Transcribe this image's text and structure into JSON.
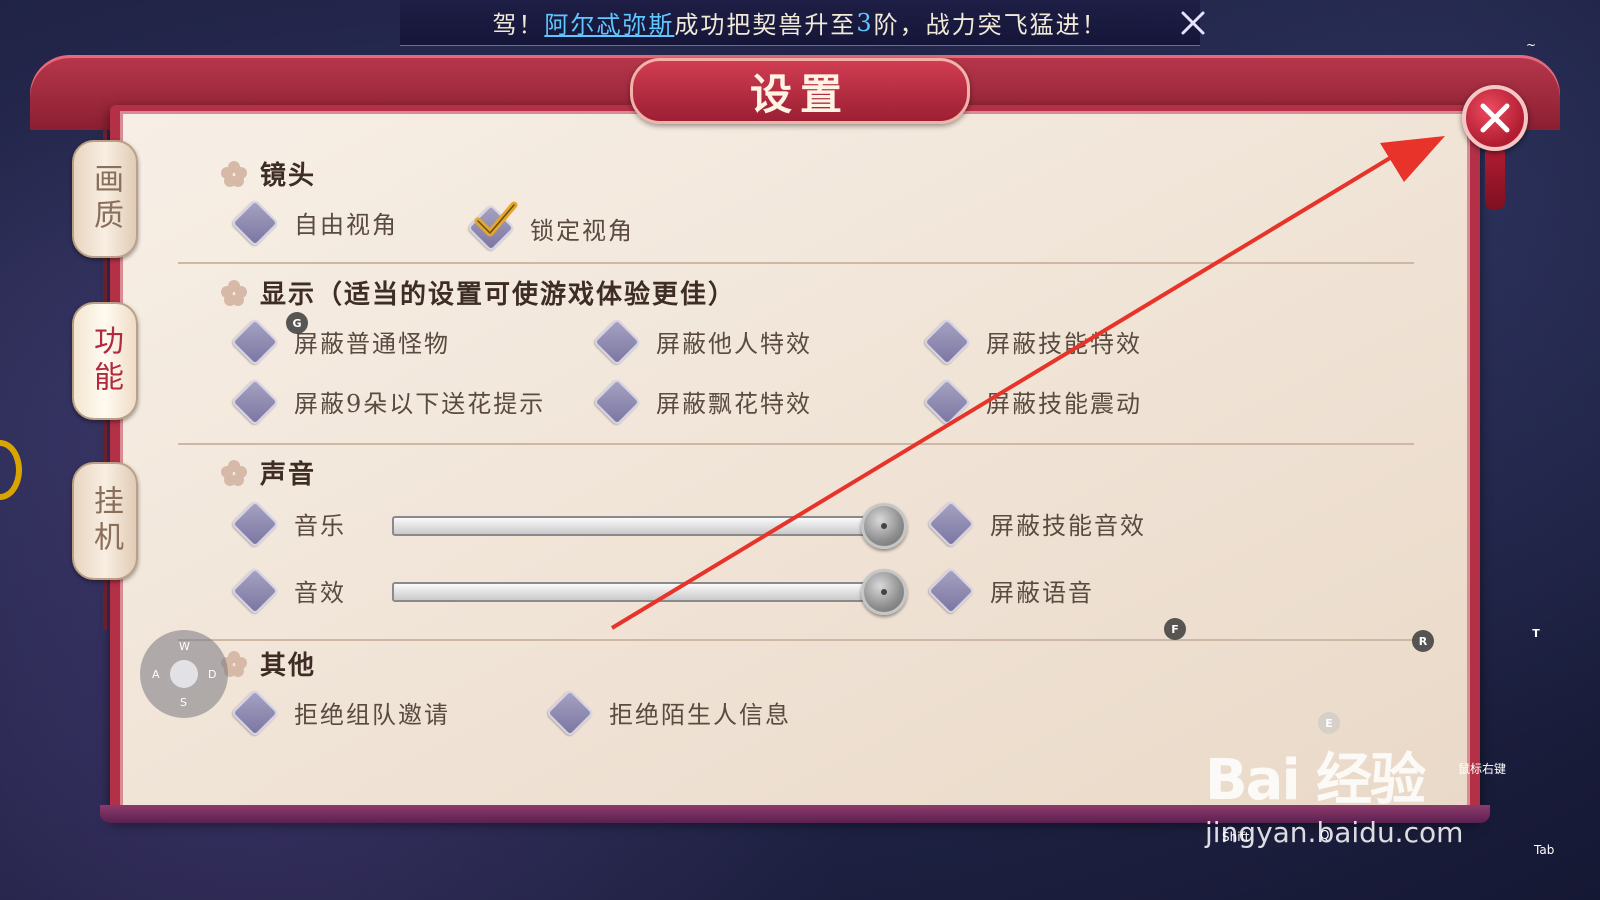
{
  "banner": {
    "prefix": "驾！",
    "player": "阿尔忒弥斯",
    "middle": "成功把契兽升至",
    "level": "3",
    "suffix": "阶，战力突飞猛进！"
  },
  "dialog": {
    "title": "设置"
  },
  "tabs": [
    {
      "label": "画质",
      "active": false
    },
    {
      "label": "功能",
      "active": true
    },
    {
      "label": "挂机",
      "active": false
    }
  ],
  "sections": {
    "camera": {
      "heading": "镜头",
      "options": [
        {
          "label": "自由视角",
          "checked": false
        },
        {
          "label": "锁定视角",
          "checked": true
        }
      ]
    },
    "display": {
      "heading": "显示（适当的设置可使游戏体验更佳）",
      "options": [
        {
          "label": "屏蔽普通怪物",
          "checked": false
        },
        {
          "label": "屏蔽他人特效",
          "checked": false
        },
        {
          "label": "屏蔽技能特效",
          "checked": false
        },
        {
          "label": "屏蔽9朵以下送花提示",
          "checked": false
        },
        {
          "label": "屏蔽飘花特效",
          "checked": false
        },
        {
          "label": "屏蔽技能震动",
          "checked": false
        }
      ]
    },
    "sound": {
      "heading": "声音",
      "music": {
        "label": "音乐",
        "level": 1.0
      },
      "sfx": {
        "label": "音效",
        "level": 1.0
      },
      "options": [
        {
          "label": "屏蔽技能音效",
          "checked": false
        },
        {
          "label": "屏蔽语音",
          "checked": false
        }
      ]
    },
    "other": {
      "heading": "其他",
      "options": [
        {
          "label": "拒绝组队邀请",
          "checked": false
        },
        {
          "label": "拒绝陌生人信息",
          "checked": false
        }
      ]
    }
  },
  "key_hints": {
    "g": "G",
    "f": "F",
    "r": "R",
    "t": "T",
    "e": "E",
    "right_key": "鼠标右键",
    "shift": "Shift",
    "q": "Q",
    "tab": "Tab",
    "tilde": "~"
  },
  "joystick": {
    "w": "W",
    "a": "A",
    "s": "S",
    "d": "D"
  },
  "watermark": {
    "brand": "Bai 经验",
    "url": "jingyan.baidu.com"
  },
  "colors": {
    "frame": "#b33047",
    "accent_text": "#5fc6ff",
    "diamond": "#8c88b0",
    "arrow": "#e8332a"
  }
}
